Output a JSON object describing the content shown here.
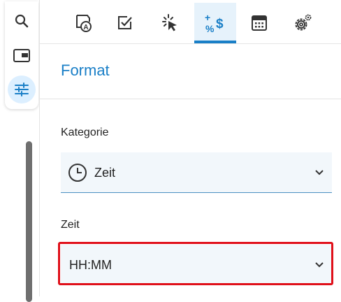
{
  "rail": {
    "items": [
      {
        "icon": "search-icon"
      },
      {
        "icon": "window-icon"
      },
      {
        "icon": "sliders-icon",
        "active": true
      }
    ]
  },
  "tabs": [
    {
      "icon": "text-format-icon"
    },
    {
      "icon": "checkbox-icon"
    },
    {
      "icon": "cursor-click-icon"
    },
    {
      "icon": "number-format-icon",
      "active": true
    },
    {
      "icon": "calculator-icon"
    },
    {
      "icon": "settings-gear-icon"
    }
  ],
  "panel": {
    "title": "Format",
    "category_label": "Kategorie",
    "category_value": "Zeit",
    "time_label": "Zeit",
    "time_value": "HH:MM"
  },
  "colors": {
    "accent": "#1a7fc7",
    "highlight": "#e0101a",
    "field_bg": "#f2f7fb"
  }
}
